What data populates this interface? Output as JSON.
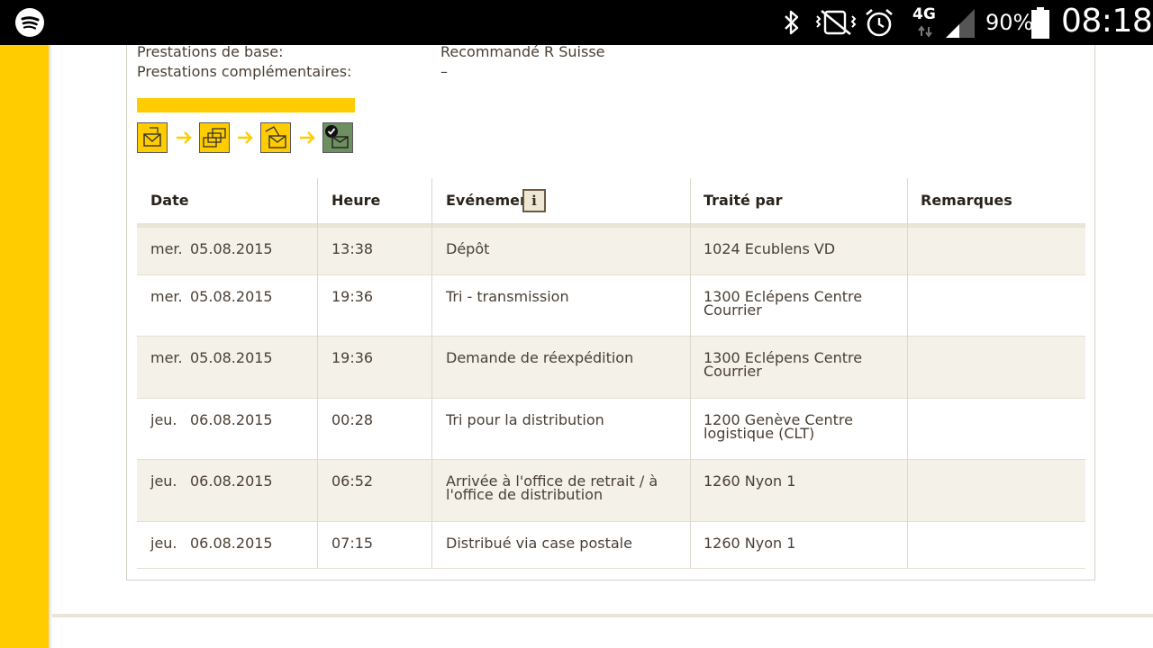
{
  "status_bar": {
    "network": "4G",
    "battery_pct": "90%",
    "time": "08:18",
    "icons": [
      "spotify-icon",
      "bluetooth-icon",
      "vibrate-icon",
      "alarm-icon",
      "signal-icon",
      "battery-icon"
    ]
  },
  "shipment": {
    "base_label": "Prestations de base:",
    "base_value": "Recommandé R Suisse",
    "extra_label": "Prestations complémentaires:",
    "extra_value": "–"
  },
  "progress": {
    "steps": [
      "deposit-icon",
      "sorting-icon",
      "arrival-icon",
      "delivered-icon"
    ],
    "completed_steps": 4,
    "colors": {
      "pending": "#ffcc00",
      "done": "#6e8f5f",
      "accent": "#ffcc00"
    }
  },
  "table": {
    "columns": [
      "Date",
      "Heure",
      "Evénement",
      "Traité par",
      "Remarques"
    ],
    "rows": [
      {
        "day": "mer.",
        "date": "05.08.2015",
        "time": "13:38",
        "event": "Dépôt",
        "by": "1024 Ecublens VD",
        "remarks": ""
      },
      {
        "day": "mer.",
        "date": "05.08.2015",
        "time": "19:36",
        "event": "Tri - transmission",
        "by": "1300 Eclépens Centre Courrier",
        "remarks": ""
      },
      {
        "day": "mer.",
        "date": "05.08.2015",
        "time": "19:36",
        "event": "Demande de réexpédition",
        "by": "1300 Eclépens Centre Courrier",
        "remarks": ""
      },
      {
        "day": "jeu.",
        "date": "06.08.2015",
        "time": "00:28",
        "event": "Tri pour la distribution",
        "by": "1200 Genève Centre logistique (CLT)",
        "remarks": ""
      },
      {
        "day": "jeu.",
        "date": "06.08.2015",
        "time": "06:52",
        "event": "Arrivée à l'office de retrait / à l'office de distribution",
        "by": "1260 Nyon 1",
        "remarks": ""
      },
      {
        "day": "jeu.",
        "date": "06.08.2015",
        "time": "07:15",
        "event": "Distribué via case postale",
        "by": "1260 Nyon 1",
        "remarks": ""
      }
    ]
  }
}
